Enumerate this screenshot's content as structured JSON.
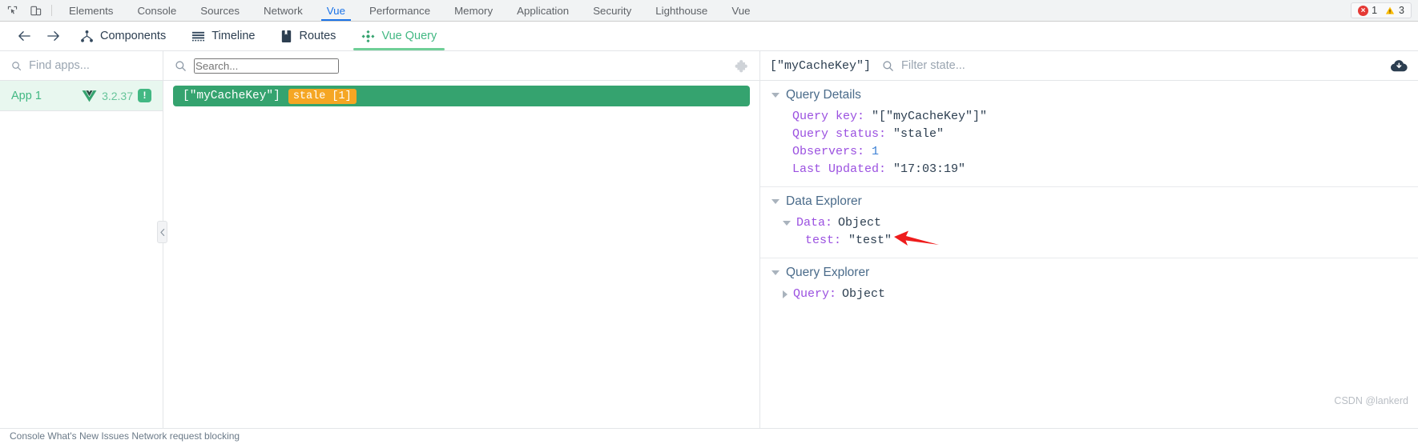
{
  "devtools": {
    "tools": [
      {
        "name": "inspect-element-icon",
        "label": "Inspect"
      },
      {
        "name": "device-toolbar-icon",
        "label": "Toggle device toolbar"
      }
    ],
    "tabs": [
      {
        "label": "Elements",
        "active": false
      },
      {
        "label": "Console",
        "active": false
      },
      {
        "label": "Sources",
        "active": false
      },
      {
        "label": "Network",
        "active": false
      },
      {
        "label": "Vue",
        "active": true
      },
      {
        "label": "Performance",
        "active": false
      },
      {
        "label": "Memory",
        "active": false
      },
      {
        "label": "Application",
        "active": false
      },
      {
        "label": "Security",
        "active": false
      },
      {
        "label": "Lighthouse",
        "active": false
      },
      {
        "label": "Vue",
        "active": false
      }
    ],
    "status": {
      "error_count": "1",
      "warning_count": "3"
    }
  },
  "vue_toolbar": {
    "back_label": "Back",
    "forward_label": "Forward",
    "tabs": [
      {
        "label": "Components",
        "icon": "components-icon",
        "active": false
      },
      {
        "label": "Timeline",
        "icon": "timeline-icon",
        "active": false
      },
      {
        "label": "Routes",
        "icon": "routes-icon",
        "active": false
      },
      {
        "label": "Vue Query",
        "icon": "vue-query-icon",
        "active": true
      }
    ]
  },
  "apps_panel": {
    "search": {
      "value": "",
      "placeholder": "Find apps..."
    },
    "items": [
      {
        "name": "App 1",
        "version": "3.2.37",
        "badge": "!",
        "selected": true
      }
    ]
  },
  "queries_panel": {
    "search": {
      "value": "",
      "placeholder": "Search..."
    },
    "extension_icon": "puzzle-piece-icon",
    "rows": [
      {
        "key": "[\"myCacheKey\"]",
        "status_badge": "stale [1]",
        "selected": true
      }
    ]
  },
  "detail_panel": {
    "title": "[\"myCacheKey\"]",
    "filter": {
      "value": "",
      "placeholder": "Filter state..."
    },
    "offline_icon": "cloud-download-icon",
    "sections": [
      {
        "title": "Query Details",
        "expanded": true,
        "rows": [
          {
            "key": "Query key:",
            "value": "\"[\"myCacheKey\"]\"",
            "value_type": "string"
          },
          {
            "key": "Query status:",
            "value": "\"stale\"",
            "value_type": "string"
          },
          {
            "key": "Observers:",
            "value": "1",
            "value_type": "number"
          },
          {
            "key": "Last Updated:",
            "value": "\"17:03:19\"",
            "value_type": "string"
          }
        ]
      },
      {
        "title": "Data Explorer",
        "expanded": true,
        "node": {
          "key": "Data:",
          "value": "Object",
          "expanded": true
        },
        "children": [
          {
            "key": "test:",
            "value": "\"test\"",
            "value_type": "string"
          }
        ]
      },
      {
        "title": "Query Explorer",
        "expanded": true,
        "node": {
          "key": "Query:",
          "value": "Object",
          "expanded": false
        },
        "children": []
      }
    ]
  },
  "annotation": {
    "arrow_color": "#ee1c1c",
    "points_at": "test value"
  },
  "watermark": "CSDN @lankerd",
  "statusbar": {
    "text": "Console   What's New   Issues   Network request blocking"
  },
  "colors": {
    "vue_green": "#42b883",
    "query_row_green": "#35a36f",
    "stale_orange": "#f5a623",
    "chrome_blue": "#1a73e8",
    "key_purple": "#9b51e0",
    "number_blue": "#3b7fd4"
  }
}
